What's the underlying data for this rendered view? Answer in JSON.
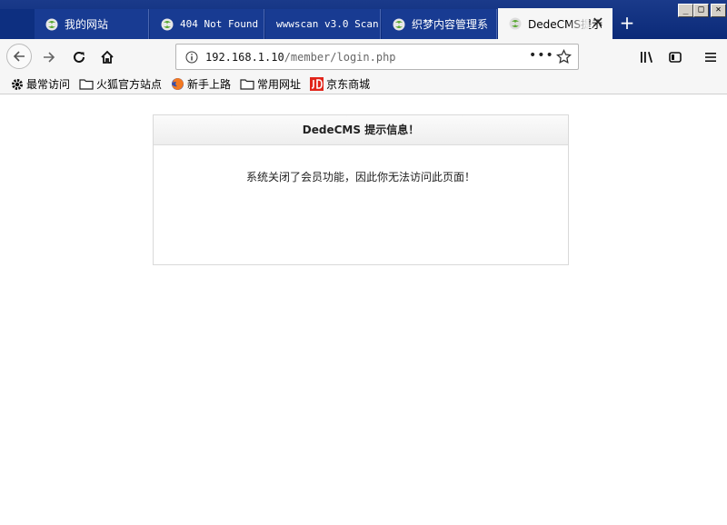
{
  "browser": {
    "tabs": [
      {
        "label": "我的网站",
        "active": false,
        "icon": "dedecms-favicon"
      },
      {
        "label": "404 Not Found",
        "active": false,
        "icon": "dedecms-favicon"
      },
      {
        "label": "wwwscan v3.0 Scan",
        "active": false,
        "icon": ""
      },
      {
        "label": "织梦内容管理系",
        "active": false,
        "icon": "dedecms-favicon"
      },
      {
        "label": "DedeCMS提示",
        "active": true,
        "icon": "dedecms-favicon"
      }
    ],
    "new_tab_label": "+",
    "close_tab_label": "✕",
    "window_controls": {
      "minimize": "_",
      "maximize": "□",
      "close": "✕"
    },
    "url": {
      "host": "192.168.1.10",
      "path": "/member/login.php"
    },
    "page_actions_label": "•••",
    "bookmarks": [
      {
        "label": "最常访问",
        "icon": "gear-icon"
      },
      {
        "label": "火狐官方站点",
        "icon": "folder-icon"
      },
      {
        "label": "新手上路",
        "icon": "firefox-icon"
      },
      {
        "label": "常用网址",
        "icon": "folder-icon"
      },
      {
        "label": "京东商城",
        "icon": "jd-icon"
      }
    ]
  },
  "page": {
    "message_title": "DedeCMS 提示信息！",
    "message_text": "系统关闭了会员功能，因此你无法访问此页面！"
  },
  "colors": {
    "tabbar": "#0b2a78",
    "active_tab": "#f6f6f6",
    "toolbar": "#f6f6f6",
    "dedecms_green": "#5aa832",
    "jd_red": "#e1251b"
  }
}
